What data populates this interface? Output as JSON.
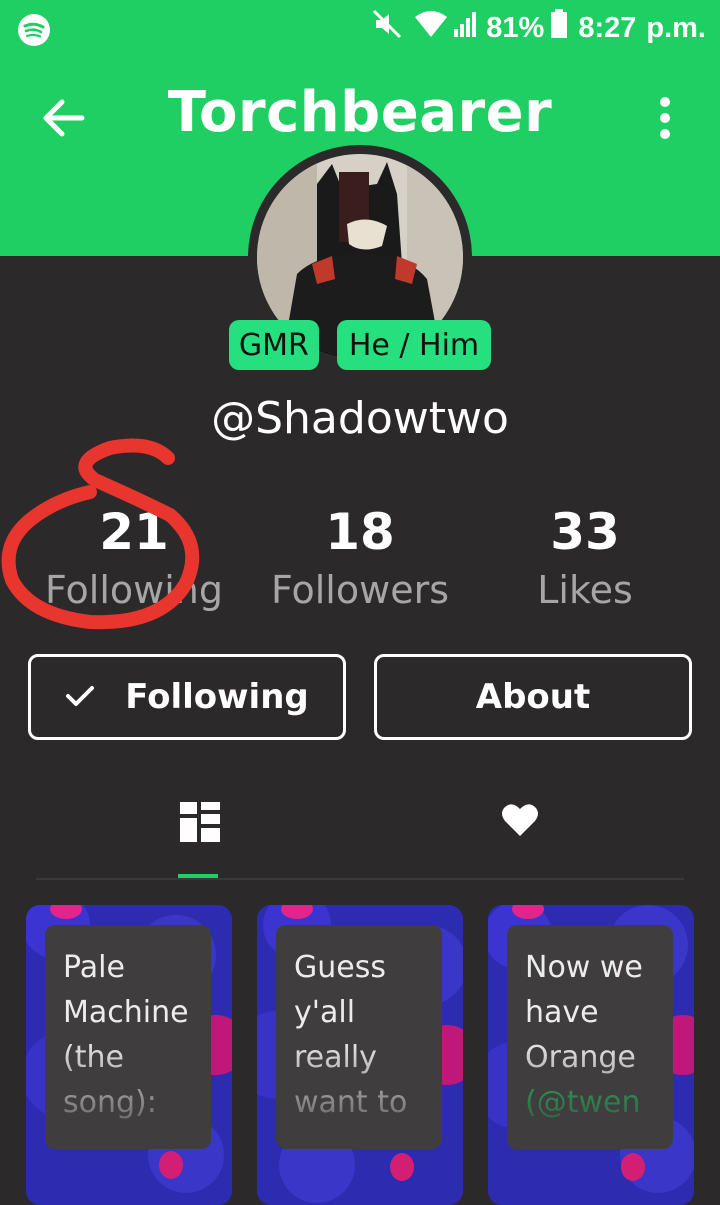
{
  "status_bar": {
    "battery": "81%",
    "time": "8:27",
    "ampm": "p.m.",
    "icons": [
      "spotify-icon",
      "mute-icon",
      "wifi-icon",
      "signal-icon",
      "battery-icon"
    ]
  },
  "header": {
    "title": "Torchbearer",
    "back_icon": "arrow-left-icon",
    "menu_icon": "more-vertical-icon"
  },
  "profile": {
    "badges": [
      "GMR",
      "He / Him"
    ],
    "username": "@Shadowtwo",
    "stats": [
      {
        "value": "21",
        "label": "Following"
      },
      {
        "value": "18",
        "label": "Followers"
      },
      {
        "value": "33",
        "label": "Likes"
      }
    ]
  },
  "actions": {
    "following_label": "Following",
    "about_label": "About"
  },
  "tabs": [
    {
      "icon": "grid-icon",
      "selected": true
    },
    {
      "icon": "heart-icon",
      "selected": false
    }
  ],
  "posts": [
    {
      "lines": [
        "Pale",
        "Machine",
        "(the",
        "song):"
      ]
    },
    {
      "lines": [
        "Guess",
        "y'all",
        "really",
        "want to"
      ]
    },
    {
      "lines": [
        "Now we",
        "have",
        "Orange"
      ],
      "mention": "(@twen"
    }
  ],
  "colors": {
    "accent": "#1fcf63",
    "badge": "#26e07f",
    "background": "#2b292a",
    "annotation": "#e8352d"
  }
}
